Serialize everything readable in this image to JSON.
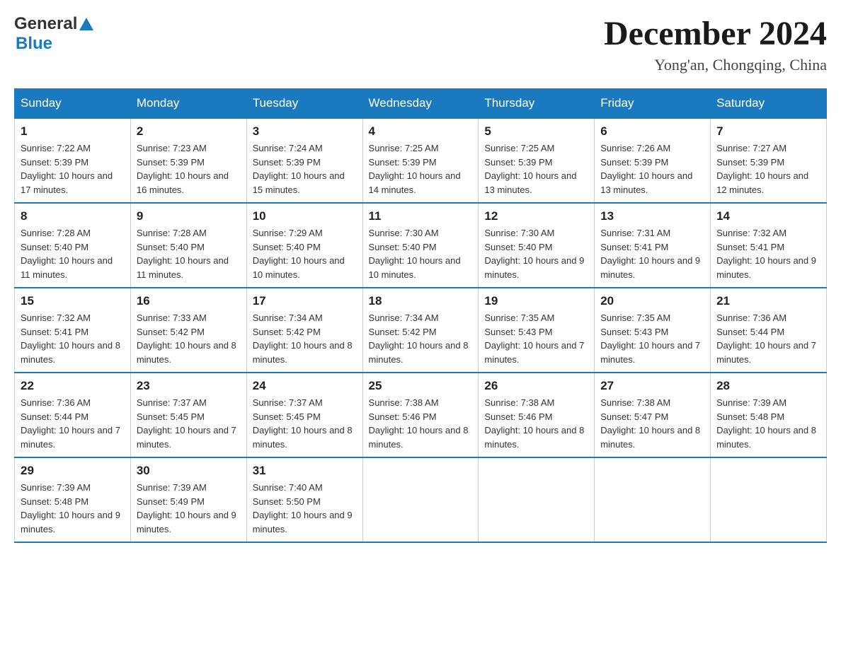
{
  "header": {
    "logo": {
      "text_general": "General",
      "text_blue": "Blue"
    },
    "month_title": "December 2024",
    "location": "Yong'an, Chongqing, China"
  },
  "calendar": {
    "days_of_week": [
      "Sunday",
      "Monday",
      "Tuesday",
      "Wednesday",
      "Thursday",
      "Friday",
      "Saturday"
    ],
    "weeks": [
      [
        {
          "day": "1",
          "sunrise": "Sunrise: 7:22 AM",
          "sunset": "Sunset: 5:39 PM",
          "daylight": "Daylight: 10 hours and 17 minutes."
        },
        {
          "day": "2",
          "sunrise": "Sunrise: 7:23 AM",
          "sunset": "Sunset: 5:39 PM",
          "daylight": "Daylight: 10 hours and 16 minutes."
        },
        {
          "day": "3",
          "sunrise": "Sunrise: 7:24 AM",
          "sunset": "Sunset: 5:39 PM",
          "daylight": "Daylight: 10 hours and 15 minutes."
        },
        {
          "day": "4",
          "sunrise": "Sunrise: 7:25 AM",
          "sunset": "Sunset: 5:39 PM",
          "daylight": "Daylight: 10 hours and 14 minutes."
        },
        {
          "day": "5",
          "sunrise": "Sunrise: 7:25 AM",
          "sunset": "Sunset: 5:39 PM",
          "daylight": "Daylight: 10 hours and 13 minutes."
        },
        {
          "day": "6",
          "sunrise": "Sunrise: 7:26 AM",
          "sunset": "Sunset: 5:39 PM",
          "daylight": "Daylight: 10 hours and 13 minutes."
        },
        {
          "day": "7",
          "sunrise": "Sunrise: 7:27 AM",
          "sunset": "Sunset: 5:39 PM",
          "daylight": "Daylight: 10 hours and 12 minutes."
        }
      ],
      [
        {
          "day": "8",
          "sunrise": "Sunrise: 7:28 AM",
          "sunset": "Sunset: 5:40 PM",
          "daylight": "Daylight: 10 hours and 11 minutes."
        },
        {
          "day": "9",
          "sunrise": "Sunrise: 7:28 AM",
          "sunset": "Sunset: 5:40 PM",
          "daylight": "Daylight: 10 hours and 11 minutes."
        },
        {
          "day": "10",
          "sunrise": "Sunrise: 7:29 AM",
          "sunset": "Sunset: 5:40 PM",
          "daylight": "Daylight: 10 hours and 10 minutes."
        },
        {
          "day": "11",
          "sunrise": "Sunrise: 7:30 AM",
          "sunset": "Sunset: 5:40 PM",
          "daylight": "Daylight: 10 hours and 10 minutes."
        },
        {
          "day": "12",
          "sunrise": "Sunrise: 7:30 AM",
          "sunset": "Sunset: 5:40 PM",
          "daylight": "Daylight: 10 hours and 9 minutes."
        },
        {
          "day": "13",
          "sunrise": "Sunrise: 7:31 AM",
          "sunset": "Sunset: 5:41 PM",
          "daylight": "Daylight: 10 hours and 9 minutes."
        },
        {
          "day": "14",
          "sunrise": "Sunrise: 7:32 AM",
          "sunset": "Sunset: 5:41 PM",
          "daylight": "Daylight: 10 hours and 9 minutes."
        }
      ],
      [
        {
          "day": "15",
          "sunrise": "Sunrise: 7:32 AM",
          "sunset": "Sunset: 5:41 PM",
          "daylight": "Daylight: 10 hours and 8 minutes."
        },
        {
          "day": "16",
          "sunrise": "Sunrise: 7:33 AM",
          "sunset": "Sunset: 5:42 PM",
          "daylight": "Daylight: 10 hours and 8 minutes."
        },
        {
          "day": "17",
          "sunrise": "Sunrise: 7:34 AM",
          "sunset": "Sunset: 5:42 PM",
          "daylight": "Daylight: 10 hours and 8 minutes."
        },
        {
          "day": "18",
          "sunrise": "Sunrise: 7:34 AM",
          "sunset": "Sunset: 5:42 PM",
          "daylight": "Daylight: 10 hours and 8 minutes."
        },
        {
          "day": "19",
          "sunrise": "Sunrise: 7:35 AM",
          "sunset": "Sunset: 5:43 PM",
          "daylight": "Daylight: 10 hours and 7 minutes."
        },
        {
          "day": "20",
          "sunrise": "Sunrise: 7:35 AM",
          "sunset": "Sunset: 5:43 PM",
          "daylight": "Daylight: 10 hours and 7 minutes."
        },
        {
          "day": "21",
          "sunrise": "Sunrise: 7:36 AM",
          "sunset": "Sunset: 5:44 PM",
          "daylight": "Daylight: 10 hours and 7 minutes."
        }
      ],
      [
        {
          "day": "22",
          "sunrise": "Sunrise: 7:36 AM",
          "sunset": "Sunset: 5:44 PM",
          "daylight": "Daylight: 10 hours and 7 minutes."
        },
        {
          "day": "23",
          "sunrise": "Sunrise: 7:37 AM",
          "sunset": "Sunset: 5:45 PM",
          "daylight": "Daylight: 10 hours and 7 minutes."
        },
        {
          "day": "24",
          "sunrise": "Sunrise: 7:37 AM",
          "sunset": "Sunset: 5:45 PM",
          "daylight": "Daylight: 10 hours and 8 minutes."
        },
        {
          "day": "25",
          "sunrise": "Sunrise: 7:38 AM",
          "sunset": "Sunset: 5:46 PM",
          "daylight": "Daylight: 10 hours and 8 minutes."
        },
        {
          "day": "26",
          "sunrise": "Sunrise: 7:38 AM",
          "sunset": "Sunset: 5:46 PM",
          "daylight": "Daylight: 10 hours and 8 minutes."
        },
        {
          "day": "27",
          "sunrise": "Sunrise: 7:38 AM",
          "sunset": "Sunset: 5:47 PM",
          "daylight": "Daylight: 10 hours and 8 minutes."
        },
        {
          "day": "28",
          "sunrise": "Sunrise: 7:39 AM",
          "sunset": "Sunset: 5:48 PM",
          "daylight": "Daylight: 10 hours and 8 minutes."
        }
      ],
      [
        {
          "day": "29",
          "sunrise": "Sunrise: 7:39 AM",
          "sunset": "Sunset: 5:48 PM",
          "daylight": "Daylight: 10 hours and 9 minutes."
        },
        {
          "day": "30",
          "sunrise": "Sunrise: 7:39 AM",
          "sunset": "Sunset: 5:49 PM",
          "daylight": "Daylight: 10 hours and 9 minutes."
        },
        {
          "day": "31",
          "sunrise": "Sunrise: 7:40 AM",
          "sunset": "Sunset: 5:50 PM",
          "daylight": "Daylight: 10 hours and 9 minutes."
        },
        null,
        null,
        null,
        null
      ]
    ]
  }
}
